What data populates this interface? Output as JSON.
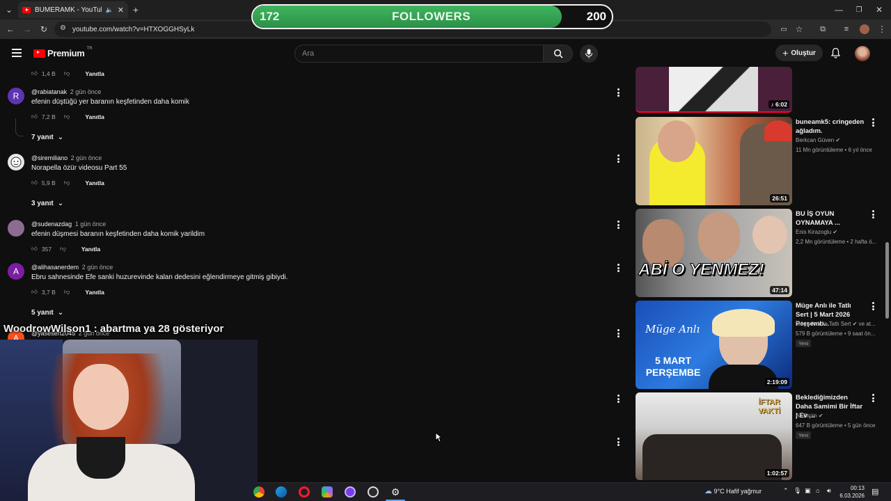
{
  "browser": {
    "tab_title": "BUMERAMK - YouTube",
    "url": "youtube.com/watch?v=HTXOGGHSyLk"
  },
  "overlay": {
    "followers_current": "172",
    "followers_label": "FOLLOWERS",
    "followers_goal": "200",
    "progress_fraction": 0.86,
    "chat_user": "WoodrowWilson1",
    "chat_message": ": abartma ya 28 gösteriyor"
  },
  "header": {
    "logo_text": "Premium",
    "logo_region": "TR",
    "search_placeholder": "Ara",
    "create_label": "Oluştur"
  },
  "comments": [
    {
      "likes": "1,4 B",
      "reply_label": "Yanıtla"
    },
    {
      "avatar_letter": "R",
      "avatar_color": "#5e35b1",
      "user": "@rabiatanak",
      "time": "2 gün önce",
      "text": "efenin düştüğü yer baranın keşfetinden daha komik",
      "likes": "7,2 B",
      "reply_label": "Yanıtla",
      "replies": "7 yanıt"
    },
    {
      "avatar_letter": "",
      "avatar_color": "#e8e8e8",
      "user": "@siremiliano",
      "time": "2 gün önce",
      "text": "Norapella özür videosu Part 55",
      "likes": "5,9 B",
      "reply_label": "Yanıtla",
      "replies": "3 yanıt"
    },
    {
      "avatar_letter": "",
      "avatar_color": "#8a6d8f",
      "user": "@sudenazdag",
      "time": "1 gün önce",
      "text": "efenin düşmesi baranın keşfetinden  daha komik yarildim",
      "likes": "357",
      "reply_label": "Yanıtla"
    },
    {
      "avatar_letter": "A",
      "avatar_color": "#7b1fa2",
      "user": "@alihasanerdem",
      "time": "2 gün önce",
      "text": "Ebru sahnesinde Efe sanki huzurevinde kalan dedesini eğlendirmeye gitmiş gibiydi.",
      "likes": "3,7 B",
      "reply_label": "Yanıtla",
      "replies": "5 yanıt"
    },
    {
      "avatar_letter": "A",
      "avatar_color": "#f4511e",
      "user": "@yasesert2045",
      "time": "2 gün önce"
    }
  ],
  "videos": [
    {
      "duration": "6:02"
    },
    {
      "title": "buneamk5: cringeden ağladım.",
      "channel": "Berkcan Güven",
      "stats": "11 Mn görüntüleme • 6 yıl önce",
      "duration": "26:51"
    },
    {
      "title": "BU İŞ OYUN OYNAMAYA ...",
      "channel": "Enis Kirazoglu",
      "stats": "2,2 Mn görüntüleme • 2 hafta ö...",
      "duration": "47:14",
      "thumb_text": "ABİ O YENMEZ!"
    },
    {
      "title": "Müge Anlı ile Tatlı Sert | 5 Mart 2026 Perşemb...",
      "channel": "Müge Anlı ile Tatlı Sert",
      "channel_suffix": "ve at...",
      "stats": "579 B görüntüleme • 9 saat ön...",
      "badge": "Yeni",
      "duration": "2:19:09",
      "thumb_brand": "Müge Anlı",
      "thumb_text": "5 MART PERŞEMBE"
    },
    {
      "title": "Beklediğimizden Daha Samimi Bir İftar | Ev ...",
      "channel": "Ali Biçim",
      "stats": "647 B görüntüleme • 5 gün önce",
      "badge": "Yeni",
      "duration": "1:02:57",
      "thumb_text": "İFTAR VAKTİ"
    }
  ],
  "taskbar": {
    "weather": "9°C  Hafif yağmur",
    "time": "00:13",
    "date": "6.03.2026"
  }
}
